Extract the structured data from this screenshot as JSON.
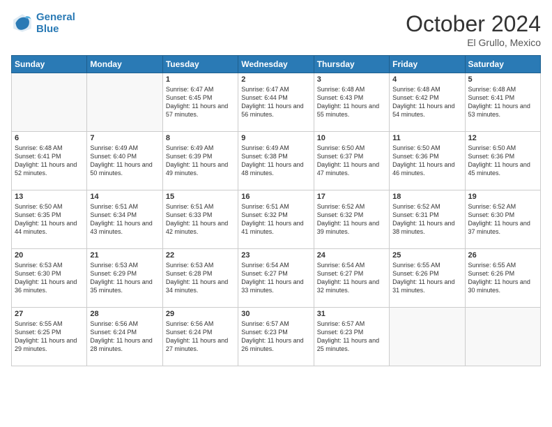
{
  "header": {
    "logo_line1": "General",
    "logo_line2": "Blue",
    "month": "October 2024",
    "location": "El Grullo, Mexico"
  },
  "weekdays": [
    "Sunday",
    "Monday",
    "Tuesday",
    "Wednesday",
    "Thursday",
    "Friday",
    "Saturday"
  ],
  "weeks": [
    [
      {
        "day": "",
        "info": ""
      },
      {
        "day": "",
        "info": ""
      },
      {
        "day": "1",
        "info": "Sunrise: 6:47 AM\nSunset: 6:45 PM\nDaylight: 11 hours and 57 minutes."
      },
      {
        "day": "2",
        "info": "Sunrise: 6:47 AM\nSunset: 6:44 PM\nDaylight: 11 hours and 56 minutes."
      },
      {
        "day": "3",
        "info": "Sunrise: 6:48 AM\nSunset: 6:43 PM\nDaylight: 11 hours and 55 minutes."
      },
      {
        "day": "4",
        "info": "Sunrise: 6:48 AM\nSunset: 6:42 PM\nDaylight: 11 hours and 54 minutes."
      },
      {
        "day": "5",
        "info": "Sunrise: 6:48 AM\nSunset: 6:41 PM\nDaylight: 11 hours and 53 minutes."
      }
    ],
    [
      {
        "day": "6",
        "info": "Sunrise: 6:48 AM\nSunset: 6:41 PM\nDaylight: 11 hours and 52 minutes."
      },
      {
        "day": "7",
        "info": "Sunrise: 6:49 AM\nSunset: 6:40 PM\nDaylight: 11 hours and 50 minutes."
      },
      {
        "day": "8",
        "info": "Sunrise: 6:49 AM\nSunset: 6:39 PM\nDaylight: 11 hours and 49 minutes."
      },
      {
        "day": "9",
        "info": "Sunrise: 6:49 AM\nSunset: 6:38 PM\nDaylight: 11 hours and 48 minutes."
      },
      {
        "day": "10",
        "info": "Sunrise: 6:50 AM\nSunset: 6:37 PM\nDaylight: 11 hours and 47 minutes."
      },
      {
        "day": "11",
        "info": "Sunrise: 6:50 AM\nSunset: 6:36 PM\nDaylight: 11 hours and 46 minutes."
      },
      {
        "day": "12",
        "info": "Sunrise: 6:50 AM\nSunset: 6:36 PM\nDaylight: 11 hours and 45 minutes."
      }
    ],
    [
      {
        "day": "13",
        "info": "Sunrise: 6:50 AM\nSunset: 6:35 PM\nDaylight: 11 hours and 44 minutes."
      },
      {
        "day": "14",
        "info": "Sunrise: 6:51 AM\nSunset: 6:34 PM\nDaylight: 11 hours and 43 minutes."
      },
      {
        "day": "15",
        "info": "Sunrise: 6:51 AM\nSunset: 6:33 PM\nDaylight: 11 hours and 42 minutes."
      },
      {
        "day": "16",
        "info": "Sunrise: 6:51 AM\nSunset: 6:32 PM\nDaylight: 11 hours and 41 minutes."
      },
      {
        "day": "17",
        "info": "Sunrise: 6:52 AM\nSunset: 6:32 PM\nDaylight: 11 hours and 39 minutes."
      },
      {
        "day": "18",
        "info": "Sunrise: 6:52 AM\nSunset: 6:31 PM\nDaylight: 11 hours and 38 minutes."
      },
      {
        "day": "19",
        "info": "Sunrise: 6:52 AM\nSunset: 6:30 PM\nDaylight: 11 hours and 37 minutes."
      }
    ],
    [
      {
        "day": "20",
        "info": "Sunrise: 6:53 AM\nSunset: 6:30 PM\nDaylight: 11 hours and 36 minutes."
      },
      {
        "day": "21",
        "info": "Sunrise: 6:53 AM\nSunset: 6:29 PM\nDaylight: 11 hours and 35 minutes."
      },
      {
        "day": "22",
        "info": "Sunrise: 6:53 AM\nSunset: 6:28 PM\nDaylight: 11 hours and 34 minutes."
      },
      {
        "day": "23",
        "info": "Sunrise: 6:54 AM\nSunset: 6:27 PM\nDaylight: 11 hours and 33 minutes."
      },
      {
        "day": "24",
        "info": "Sunrise: 6:54 AM\nSunset: 6:27 PM\nDaylight: 11 hours and 32 minutes."
      },
      {
        "day": "25",
        "info": "Sunrise: 6:55 AM\nSunset: 6:26 PM\nDaylight: 11 hours and 31 minutes."
      },
      {
        "day": "26",
        "info": "Sunrise: 6:55 AM\nSunset: 6:26 PM\nDaylight: 11 hours and 30 minutes."
      }
    ],
    [
      {
        "day": "27",
        "info": "Sunrise: 6:55 AM\nSunset: 6:25 PM\nDaylight: 11 hours and 29 minutes."
      },
      {
        "day": "28",
        "info": "Sunrise: 6:56 AM\nSunset: 6:24 PM\nDaylight: 11 hours and 28 minutes."
      },
      {
        "day": "29",
        "info": "Sunrise: 6:56 AM\nSunset: 6:24 PM\nDaylight: 11 hours and 27 minutes."
      },
      {
        "day": "30",
        "info": "Sunrise: 6:57 AM\nSunset: 6:23 PM\nDaylight: 11 hours and 26 minutes."
      },
      {
        "day": "31",
        "info": "Sunrise: 6:57 AM\nSunset: 6:23 PM\nDaylight: 11 hours and 25 minutes."
      },
      {
        "day": "",
        "info": ""
      },
      {
        "day": "",
        "info": ""
      }
    ]
  ]
}
